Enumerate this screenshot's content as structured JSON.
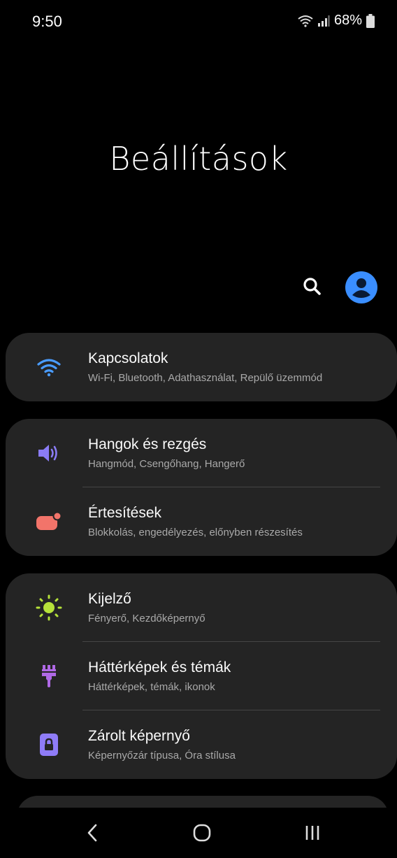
{
  "status": {
    "time": "9:50",
    "battery": "68%"
  },
  "header": {
    "title": "Beállítások"
  },
  "actions": {
    "search_icon": "search-icon",
    "avatar_icon": "account-icon"
  },
  "groups": [
    {
      "items": [
        {
          "label": "Kapcsolatok",
          "sub": "Wi-Fi, Bluetooth, Adathasználat, Repülő üzemmód",
          "icon": "wifi-icon",
          "color": "#4a9cff"
        }
      ]
    },
    {
      "items": [
        {
          "label": "Hangok és rezgés",
          "sub": "Hangmód, Csengőhang, Hangerő",
          "icon": "volume-icon",
          "color": "#8a7cf6"
        },
        {
          "label": "Értesítések",
          "sub": "Blokkolás, engedélyezés, előnyben részesítés",
          "icon": "notification-icon",
          "color": "#f2746a"
        }
      ]
    },
    {
      "items": [
        {
          "label": "Kijelző",
          "sub": "Fényerő, Kezdőképernyő",
          "icon": "brightness-icon",
          "color": "#b6e23a"
        },
        {
          "label": "Háttérképek és témák",
          "sub": "Háttérképek, témák, ikonok",
          "icon": "paintbrush-icon",
          "color": "#b069e6"
        },
        {
          "label": "Zárolt képernyő",
          "sub": "Képernyőzár típusa, Óra stílusa",
          "icon": "lock-screen-icon",
          "color": "#8f7cf7"
        }
      ]
    }
  ],
  "colors": {
    "background": "#000000",
    "card": "#242424",
    "avatar": "#3a8eff"
  }
}
